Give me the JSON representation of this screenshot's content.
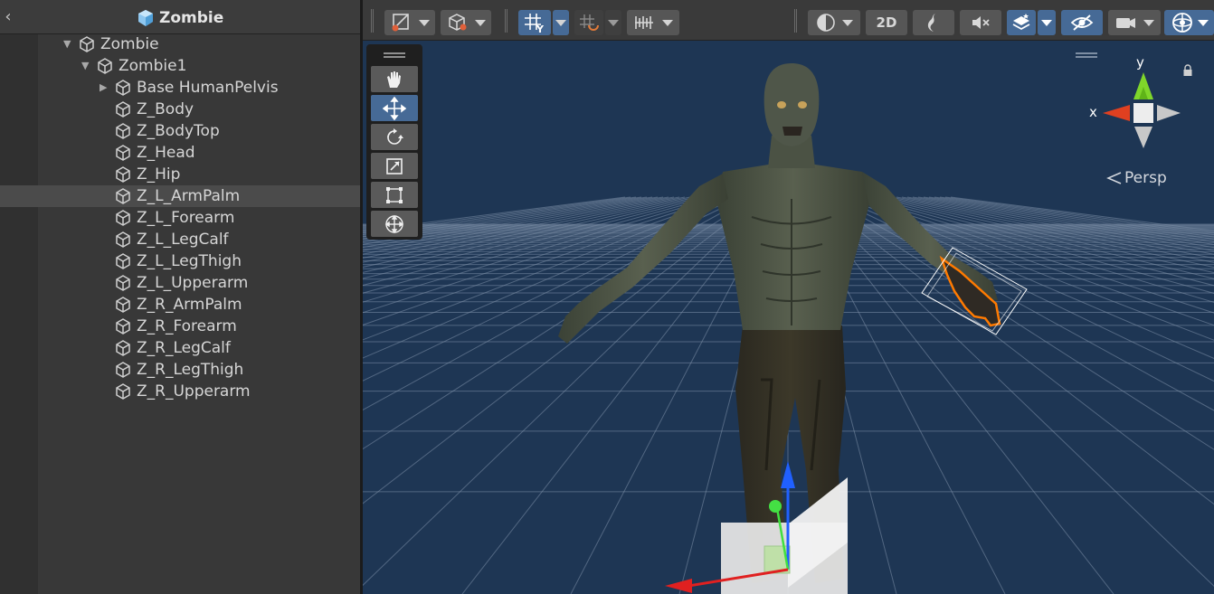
{
  "hierarchy": {
    "title": "Zombie",
    "back_icon": "chevron-left-icon",
    "items": [
      {
        "label": "Zombie",
        "depth": 0,
        "fold": "expanded"
      },
      {
        "label": "Zombie1",
        "depth": 1,
        "fold": "expanded"
      },
      {
        "label": "Base HumanPelvis",
        "depth": 2,
        "fold": "collapsed"
      },
      {
        "label": "Z_Body",
        "depth": 2,
        "fold": "none"
      },
      {
        "label": "Z_BodyTop",
        "depth": 2,
        "fold": "none"
      },
      {
        "label": "Z_Head",
        "depth": 2,
        "fold": "none"
      },
      {
        "label": "Z_Hip",
        "depth": 2,
        "fold": "none"
      },
      {
        "label": "Z_L_ArmPalm",
        "depth": 2,
        "fold": "none",
        "selected": true
      },
      {
        "label": "Z_L_Forearm",
        "depth": 2,
        "fold": "none"
      },
      {
        "label": "Z_L_LegCalf",
        "depth": 2,
        "fold": "none"
      },
      {
        "label": "Z_L_LegThigh",
        "depth": 2,
        "fold": "none"
      },
      {
        "label": "Z_L_Upperarm",
        "depth": 2,
        "fold": "none"
      },
      {
        "label": "Z_R_ArmPalm",
        "depth": 2,
        "fold": "none"
      },
      {
        "label": "Z_R_Forearm",
        "depth": 2,
        "fold": "none"
      },
      {
        "label": "Z_R_LegCalf",
        "depth": 2,
        "fold": "none"
      },
      {
        "label": "Z_R_LegThigh",
        "depth": 2,
        "fold": "none"
      },
      {
        "label": "Z_R_Upperarm",
        "depth": 2,
        "fold": "none"
      }
    ]
  },
  "scene_toolbar": {
    "draw_mode_icon": "draw-mode-icon",
    "render_mode_icon": "render-cube-icon",
    "grid_snap_icon": "grid-snap-icon",
    "increment_snap_icon": "increment-snap-icon",
    "ruler_icon": "ruler-icon",
    "shading_icon": "shading-sphere-icon",
    "mode_2d_label": "2D",
    "lighting_icon": "lighting-icon",
    "audio_icon": "audio-mute-icon",
    "effects_icon": "effects-layers-icon",
    "visibility_icon": "scene-visibility-icon",
    "camera_icon": "camera-icon",
    "gizmos_icon": "gizmos-icon"
  },
  "tools": [
    {
      "name": "hand-tool",
      "icon": "hand-icon",
      "active": false
    },
    {
      "name": "move-tool",
      "icon": "move-arrows-icon",
      "active": true
    },
    {
      "name": "rotate-tool",
      "icon": "rotate-icon",
      "active": false
    },
    {
      "name": "scale-tool",
      "icon": "scale-icon",
      "active": false
    },
    {
      "name": "rect-tool",
      "icon": "rect-transform-icon",
      "active": false
    },
    {
      "name": "transform-tool",
      "icon": "transform-icon",
      "active": false
    }
  ],
  "gizmo": {
    "y_label": "y",
    "x_label": "x",
    "projection_label": "Persp"
  },
  "colors": {
    "panel_bg": "#383838",
    "selected_row": "#4b4b4b",
    "active_blue": "#466a96",
    "scene_bg": "#1e3654",
    "selection_outline": "#ff7a00"
  }
}
